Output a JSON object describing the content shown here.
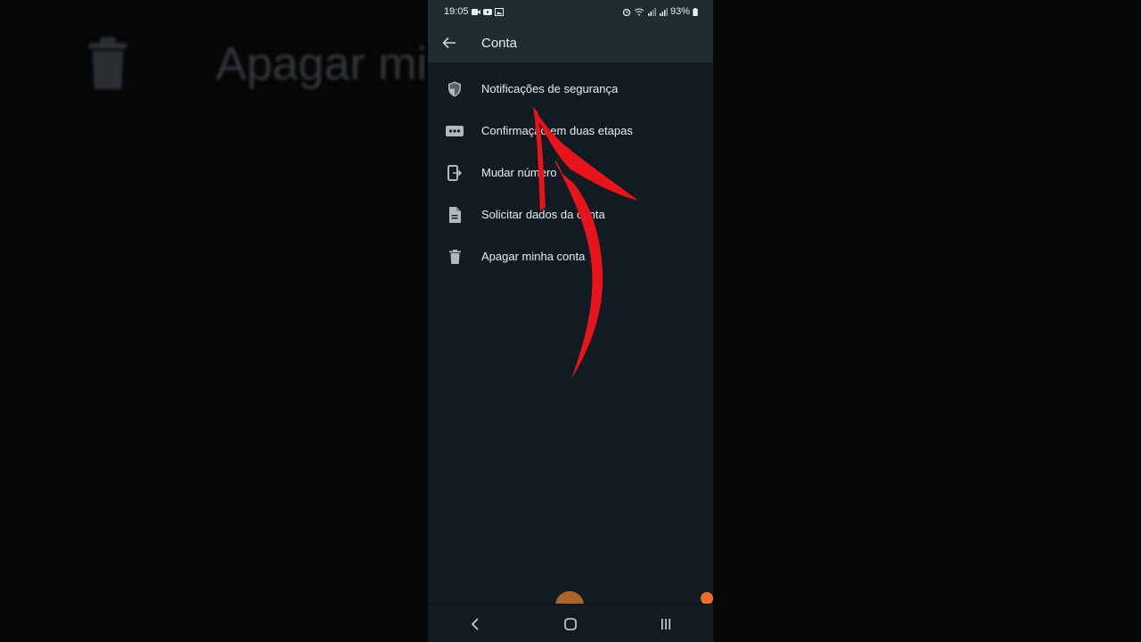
{
  "background": {
    "echo_text": "Apagar mi",
    "echo_icon": "trash-icon"
  },
  "status_bar": {
    "time": "19:05",
    "left_icons": [
      "video-call-icon",
      "youtube-icon",
      "gallery-icon"
    ],
    "right_icons": [
      "alarm-icon",
      "wifi-icon",
      "signal-icon",
      "signal-icon",
      "battery-icon"
    ],
    "battery": "93%"
  },
  "app_bar": {
    "back_icon": "arrow-left-icon",
    "title": "Conta"
  },
  "menu": {
    "items": [
      {
        "label": "Notificações de segurança",
        "icon": "shield-icon"
      },
      {
        "label": "Confirmação em duas etapas",
        "icon": "dots-box-icon"
      },
      {
        "label": "Mudar número",
        "icon": "phone-transfer-icon"
      },
      {
        "label": "Solicitar dados da conta",
        "icon": "document-icon"
      },
      {
        "label": "Apagar minha conta",
        "icon": "trash-icon"
      }
    ]
  },
  "nav_bar": {
    "buttons": [
      "back-icon",
      "home-icon",
      "recents-icon"
    ]
  },
  "colors": {
    "surface": "#111b21",
    "bar": "#1f2c34",
    "text": "#e9edef",
    "icon": "#aebac1",
    "annotation": "#e8141c"
  }
}
